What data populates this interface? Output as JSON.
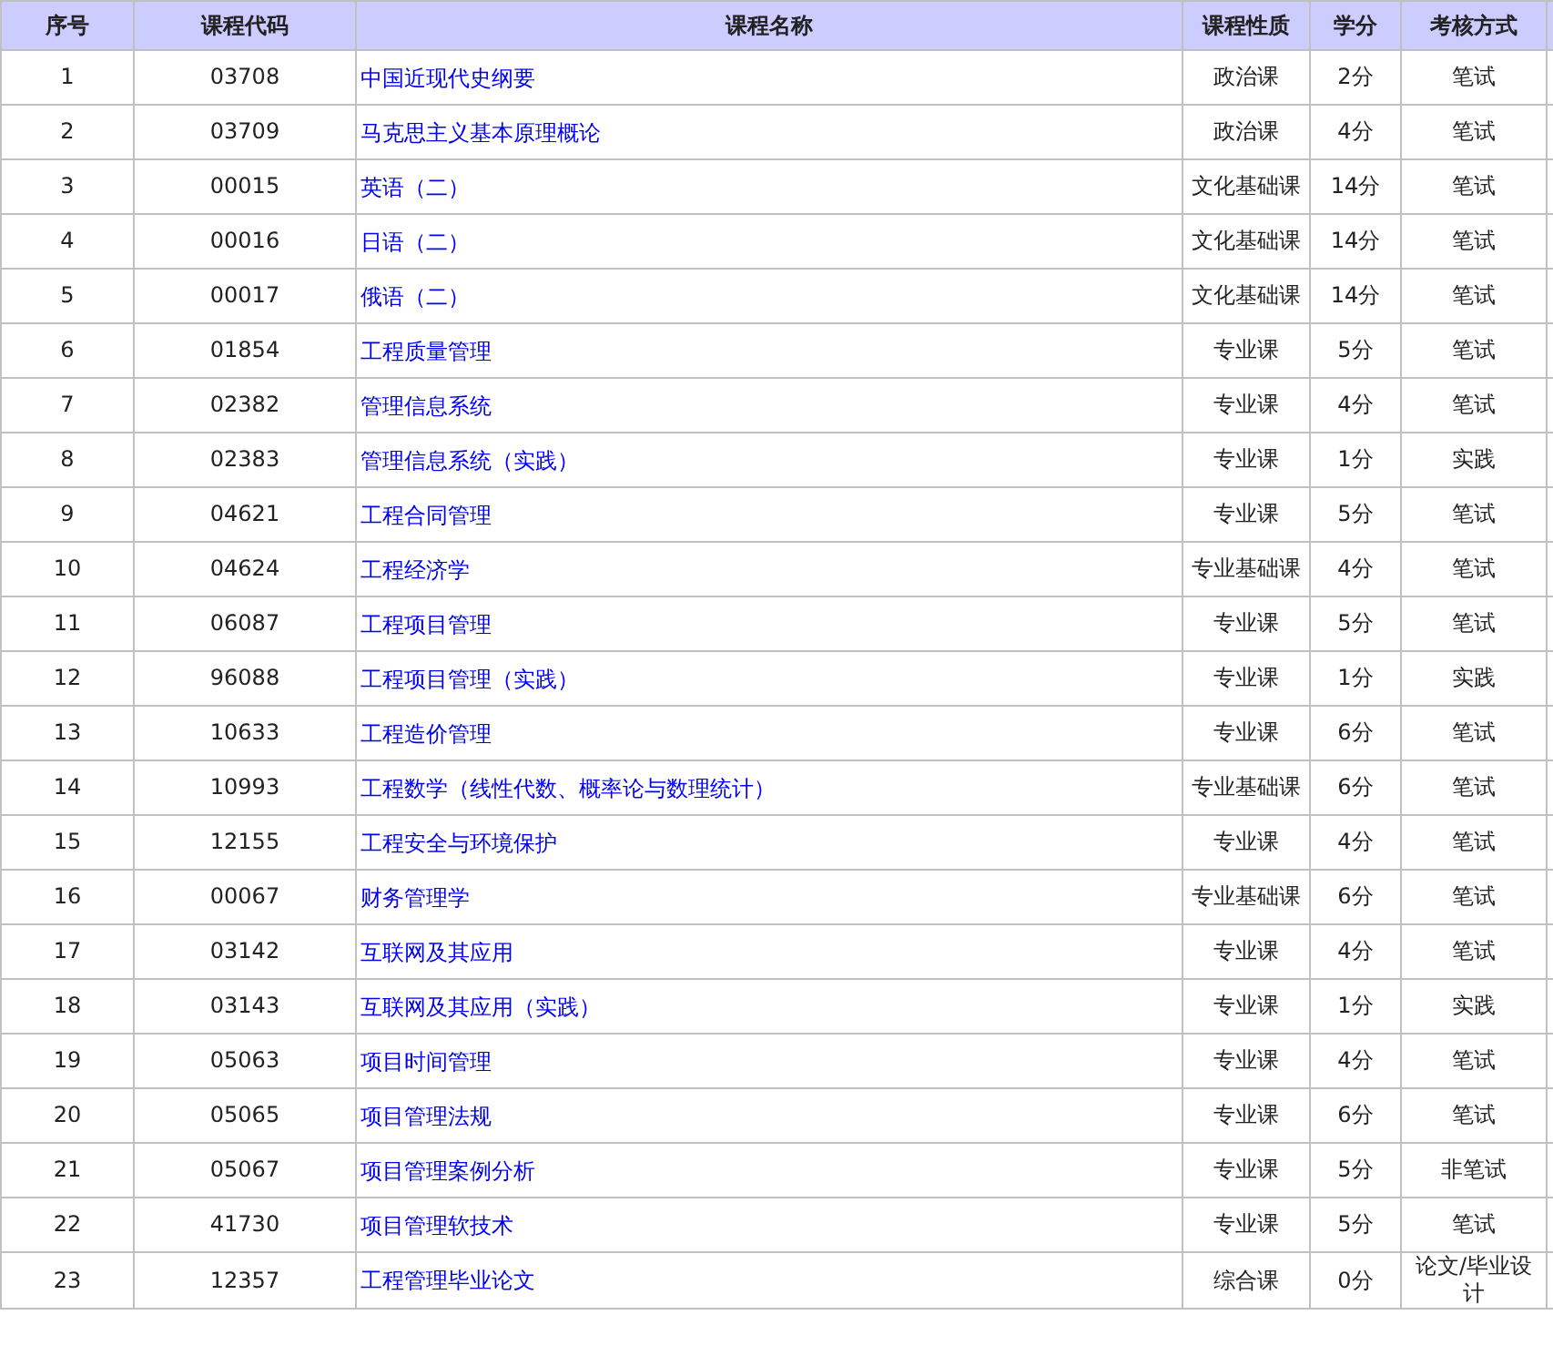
{
  "table": {
    "columns": [
      "序号",
      "课程代码",
      "课程名称",
      "课程性质",
      "学分",
      "考核方式"
    ],
    "rows": [
      [
        "1",
        "03708",
        "中国近现代史纲要",
        "政治课",
        "2分",
        "笔试"
      ],
      [
        "2",
        "03709",
        "马克思主义基本原理概论",
        "政治课",
        "4分",
        "笔试"
      ],
      [
        "3",
        "00015",
        "英语（二）",
        "文化基础课",
        "14分",
        "笔试"
      ],
      [
        "4",
        "00016",
        "日语（二）",
        "文化基础课",
        "14分",
        "笔试"
      ],
      [
        "5",
        "00017",
        "俄语（二）",
        "文化基础课",
        "14分",
        "笔试"
      ],
      [
        "6",
        "01854",
        "工程质量管理",
        "专业课",
        "5分",
        "笔试"
      ],
      [
        "7",
        "02382",
        "管理信息系统",
        "专业课",
        "4分",
        "笔试"
      ],
      [
        "8",
        "02383",
        "管理信息系统（实践）",
        "专业课",
        "1分",
        "实践"
      ],
      [
        "9",
        "04621",
        "工程合同管理",
        "专业课",
        "5分",
        "笔试"
      ],
      [
        "10",
        "04624",
        "工程经济学",
        "专业基础课",
        "4分",
        "笔试"
      ],
      [
        "11",
        "06087",
        "工程项目管理",
        "专业课",
        "5分",
        "笔试"
      ],
      [
        "12",
        "96088",
        "工程项目管理（实践）",
        "专业课",
        "1分",
        "实践"
      ],
      [
        "13",
        "10633",
        "工程造价管理",
        "专业课",
        "6分",
        "笔试"
      ],
      [
        "14",
        "10993",
        "工程数学（线性代数、概率论与数理统计）",
        "专业基础课",
        "6分",
        "笔试"
      ],
      [
        "15",
        "12155",
        "工程安全与环境保护",
        "专业课",
        "4分",
        "笔试"
      ],
      [
        "16",
        "00067",
        "财务管理学",
        "专业基础课",
        "6分",
        "笔试"
      ],
      [
        "17",
        "03142",
        "互联网及其应用",
        "专业课",
        "4分",
        "笔试"
      ],
      [
        "18",
        "03143",
        "互联网及其应用（实践）",
        "专业课",
        "1分",
        "实践"
      ],
      [
        "19",
        "05063",
        "项目时间管理",
        "专业课",
        "4分",
        "笔试"
      ],
      [
        "20",
        "05065",
        "项目管理法规",
        "专业课",
        "6分",
        "笔试"
      ],
      [
        "21",
        "05067",
        "项目管理案例分析",
        "专业课",
        "5分",
        "非笔试"
      ],
      [
        "22",
        "41730",
        "项目管理软技术",
        "专业课",
        "5分",
        "笔试"
      ],
      [
        "23",
        "12357",
        "工程管理毕业论文",
        "综合课",
        "0分",
        "论文/毕业设计"
      ]
    ]
  }
}
